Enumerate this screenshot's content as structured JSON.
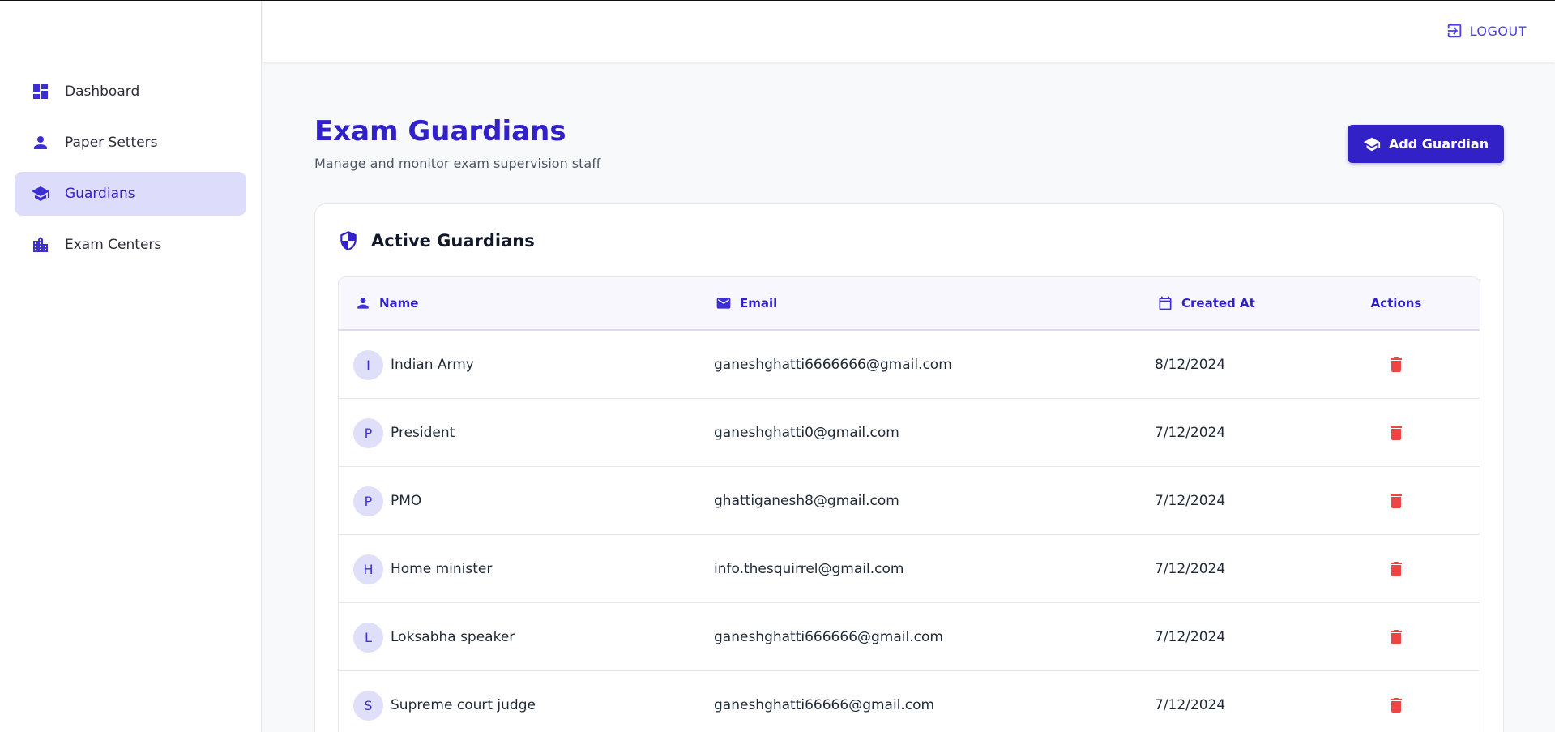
{
  "sidebar": {
    "items": [
      {
        "label": "Dashboard",
        "icon": "dashboard-icon",
        "active": false
      },
      {
        "label": "Paper Setters",
        "icon": "person-icon",
        "active": false
      },
      {
        "label": "Guardians",
        "icon": "graduation-cap-icon",
        "active": true
      },
      {
        "label": "Exam Centers",
        "icon": "building-icon",
        "active": false
      }
    ]
  },
  "header": {
    "logout_label": "LOGOUT"
  },
  "page": {
    "title": "Exam Guardians",
    "subtitle": "Manage and monitor exam supervision staff",
    "add_button_label": "Add Guardian"
  },
  "card": {
    "title": "Active Guardians",
    "columns": {
      "name": "Name",
      "email": "Email",
      "created": "Created At",
      "actions": "Actions"
    },
    "rows": [
      {
        "initial": "I",
        "name": "Indian Army",
        "email": "ganeshghatti6666666@gmail.com",
        "created": "8/12/2024"
      },
      {
        "initial": "P",
        "name": "President",
        "email": "ganeshghatti0@gmail.com",
        "created": "7/12/2024"
      },
      {
        "initial": "P",
        "name": "PMO",
        "email": "ghattiganesh8@gmail.com",
        "created": "7/12/2024"
      },
      {
        "initial": "H",
        "name": "Home minister",
        "email": "info.thesquirrel@gmail.com",
        "created": "7/12/2024"
      },
      {
        "initial": "L",
        "name": "Loksabha speaker",
        "email": "ganeshghatti666666@gmail.com",
        "created": "7/12/2024"
      },
      {
        "initial": "S",
        "name": "Supreme court judge",
        "email": "ganeshghatti66666@gmail.com",
        "created": "7/12/2024"
      }
    ]
  },
  "colors": {
    "accent": "#3321c8",
    "active_nav_bg": "#dedcfb",
    "danger": "#ef4444"
  }
}
